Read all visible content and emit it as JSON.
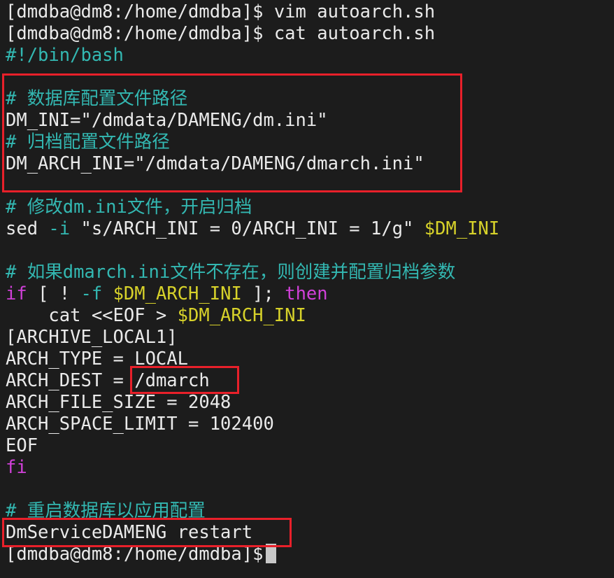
{
  "prompt1": "[dmdba@dm8:/home/dmdba]$ ",
  "cmd1": "vim autoarch.sh",
  "prompt2": "[dmdba@dm8:/home/dmdba]$ ",
  "cmd2": "cat autoarch.sh",
  "shebang": "#!/bin/bash",
  "comment_db_path": "# 数据库配置文件路径",
  "dm_ini_line": "DM_INI=\"/dmdata/DAMENG/dm.ini\"",
  "comment_arch_path": "# 归档配置文件路径",
  "dm_arch_ini_line": "DM_ARCH_INI=\"/dmdata/DAMENG/dmarch.ini\"",
  "comment_modify_pre": "# 修改",
  "comment_modify_kw": "dm.ini",
  "comment_modify_post": "文件，开启归档",
  "sed_cmd": "sed ",
  "sed_opt": "-i",
  "sed_arg": " \"s/ARCH_INI = 0/ARCH_INI = 1/g\" ",
  "sed_var": "$DM_INI",
  "comment_if_pre": "# 如果",
  "comment_if_kw": "dmarch.ini",
  "comment_if_post": "文件不存在，则创建并配置归档参数",
  "if_kw": "if",
  "if_mid1": " [ ! ",
  "if_opt": "-f",
  "if_sp": " ",
  "if_var": "$DM_ARCH_INI",
  "if_mid2": " ]; ",
  "then_kw": "then",
  "cat_heredoc": "    cat <<EOF > ",
  "cat_var": "$DM_ARCH_INI",
  "archive_section": "[ARCHIVE_LOCAL1]",
  "arch_type": "ARCH_TYPE = LOCAL",
  "arch_dest_key": "ARCH_DEST = ",
  "arch_dest_val": "/dmarch",
  "arch_file_size": "ARCH_FILE_SIZE = 2048",
  "arch_space_limit": "ARCH_SPACE_LIMIT = 102400",
  "eof": "EOF",
  "fi_kw": "fi",
  "comment_restart": "# 重启数据库以应用配置",
  "restart_cmd": "DmServiceDAMENG restart",
  "prompt3": "[dmdba@dm8:/home/dmdba]$",
  "colors": {
    "background": "#1c1c1c",
    "text": "#eaeaea",
    "comment": "#33b8b2",
    "keyword": "#d040d8",
    "variable": "#d7d22a",
    "highlight_box": "#e8202a"
  }
}
